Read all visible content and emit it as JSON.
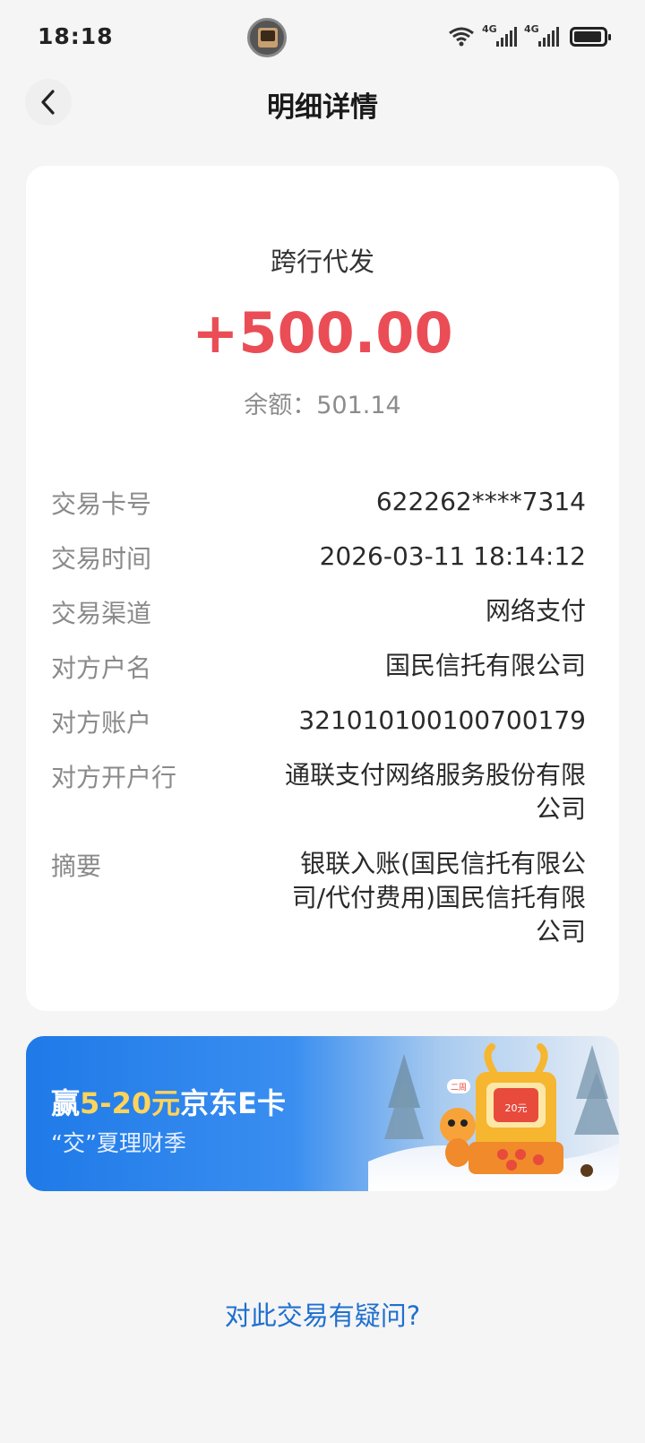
{
  "status_bar": {
    "time": "18:18",
    "signal_label_1": "4G",
    "signal_label_2": "4G"
  },
  "header": {
    "title": "明细详情",
    "back_icon": "chevron-left-icon"
  },
  "transaction": {
    "type": "跨行代发",
    "amount": "+500.00",
    "balance": "余额：501.14",
    "amount_color": "#ea4d55"
  },
  "details": [
    {
      "label": "交易卡号",
      "value": "622262****7314"
    },
    {
      "label": "交易时间",
      "value": "2026-03-11 18:14:12"
    },
    {
      "label": "交易渠道",
      "value": "网络支付"
    },
    {
      "label": "对方户名",
      "value": "国民信托有限公司"
    },
    {
      "label": "对方账户",
      "value": "321010100100700179"
    },
    {
      "label": "对方开户行",
      "value": "通联支付网络服务股份有限公司"
    },
    {
      "label": "摘要",
      "value": "银联入账(国民信托有限公司/代付费用)国民信托有限公司"
    }
  ],
  "banner": {
    "title_prefix": "赢",
    "title_highlight": "5-20元",
    "title_suffix": "京东E卡",
    "subtitle": "“交”夏理财季",
    "badge_text": "20元",
    "tag_text": "二周"
  },
  "footer": {
    "query_link": "对此交易有疑问?",
    "link_color": "#1f6fcf"
  }
}
